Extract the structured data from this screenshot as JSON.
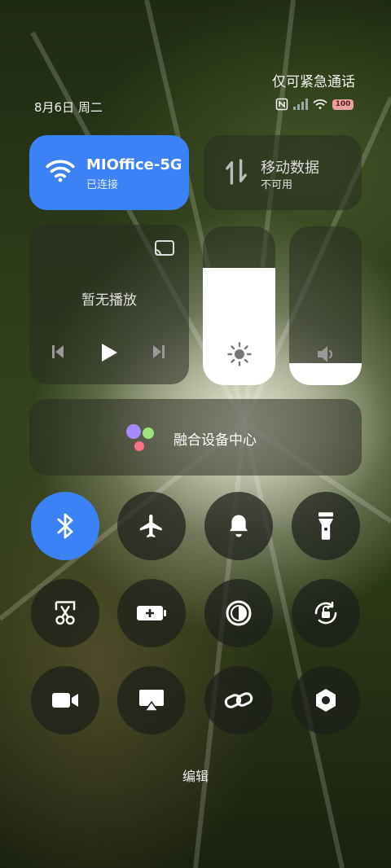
{
  "status": {
    "emergency_text": "仅可紧急通话",
    "date_text": "8月6日 周二",
    "battery_level": "100",
    "icons": [
      "nfc-icon",
      "signal-icon",
      "wifi-status-icon",
      "battery-icon"
    ]
  },
  "wifi_tile": {
    "title": "MIOffice-5G",
    "subtitle": "已连接",
    "active": true,
    "icon": "wifi-icon"
  },
  "data_tile": {
    "title": "移动数据",
    "subtitle": "不可用",
    "active": false,
    "icon": "mobile-data-icon"
  },
  "media": {
    "status": "暂无播放",
    "icons": [
      "cast-icon",
      "previous-icon",
      "play-icon",
      "next-icon"
    ]
  },
  "brightness": {
    "level": 0.74,
    "icon": "brightness-icon"
  },
  "volume": {
    "level": 0.14,
    "icon": "volume-icon"
  },
  "device_center": {
    "label": "融合设备中心",
    "icon": "device-center-icon"
  },
  "toggles": [
    {
      "name": "bluetooth",
      "icon": "bluetooth-icon",
      "active": true
    },
    {
      "name": "airplane-mode",
      "icon": "airplane-icon",
      "active": false
    },
    {
      "name": "ring",
      "icon": "bell-icon",
      "active": false
    },
    {
      "name": "flashlight",
      "icon": "flashlight-icon",
      "active": false
    },
    {
      "name": "screenshot",
      "icon": "scissors-icon",
      "active": false
    },
    {
      "name": "battery-saver",
      "icon": "battery-plus-icon",
      "active": false
    },
    {
      "name": "dark-mode",
      "icon": "contrast-icon",
      "active": false
    },
    {
      "name": "rotation-lock",
      "icon": "rotation-lock-icon",
      "active": false
    },
    {
      "name": "screen-record",
      "icon": "video-icon",
      "active": false
    },
    {
      "name": "cast-screen",
      "icon": "airplay-icon",
      "active": false
    },
    {
      "name": "link-share",
      "icon": "link-icon",
      "active": false
    },
    {
      "name": "settings",
      "icon": "hexagon-settings-icon",
      "active": false
    }
  ],
  "edit_label": "编辑",
  "colors": {
    "accent": "#3b82f6",
    "tile_bg": "rgba(40,44,34,0.55)",
    "battery": "#e9a0a0"
  }
}
